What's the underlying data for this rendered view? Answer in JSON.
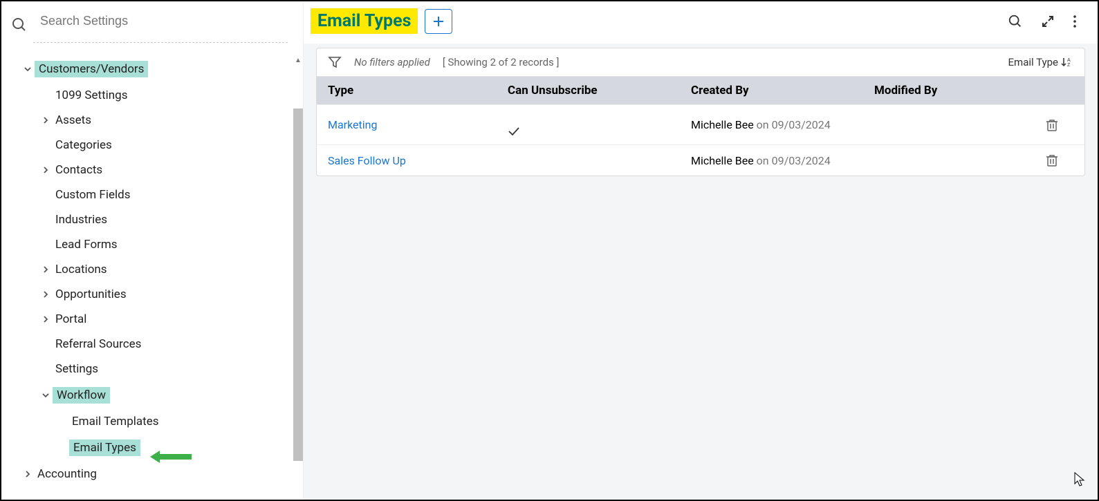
{
  "search": {
    "placeholder": "Search Settings"
  },
  "sidebar": {
    "items": [
      {
        "label": "Customers/Vendors",
        "level": 0,
        "chevron": "down",
        "highlight": true
      },
      {
        "label": "1099 Settings",
        "level": 1,
        "chevron": ""
      },
      {
        "label": "Assets",
        "level": 1,
        "chevron": "right"
      },
      {
        "label": "Categories",
        "level": 1,
        "chevron": ""
      },
      {
        "label": "Contacts",
        "level": 1,
        "chevron": "right"
      },
      {
        "label": "Custom Fields",
        "level": 1,
        "chevron": ""
      },
      {
        "label": "Industries",
        "level": 1,
        "chevron": ""
      },
      {
        "label": "Lead Forms",
        "level": 1,
        "chevron": ""
      },
      {
        "label": "Locations",
        "level": 1,
        "chevron": "right"
      },
      {
        "label": "Opportunities",
        "level": 1,
        "chevron": "right"
      },
      {
        "label": "Portal",
        "level": 1,
        "chevron": "right"
      },
      {
        "label": "Referral Sources",
        "level": 1,
        "chevron": ""
      },
      {
        "label": "Settings",
        "level": 1,
        "chevron": ""
      },
      {
        "label": "Workflow",
        "level": 1,
        "chevron": "down",
        "highlight": true
      },
      {
        "label": "Email Templates",
        "level": 2,
        "chevron": ""
      },
      {
        "label": "Email Types",
        "level": 2,
        "chevron": "",
        "highlight": true
      },
      {
        "label": "Accounting",
        "level": 0,
        "chevron": "right"
      }
    ]
  },
  "header": {
    "title": "Email Types"
  },
  "filter": {
    "no_filters": "No filters applied",
    "records": "[ Showing 2 of 2 records ]",
    "sort_label": "Email Type"
  },
  "table": {
    "columns": {
      "type": "Type",
      "unsub": "Can Unsubscribe",
      "created": "Created By",
      "modified": "Modified By"
    },
    "rows": [
      {
        "type": "Marketing",
        "unsub": true,
        "created_by": "Michelle Bee",
        "created_on_prefix": "on ",
        "created_on": "09/03/2024"
      },
      {
        "type": "Sales Follow Up",
        "unsub": false,
        "created_by": "Michelle Bee",
        "created_on_prefix": "on ",
        "created_on": "09/03/2024"
      }
    ]
  }
}
